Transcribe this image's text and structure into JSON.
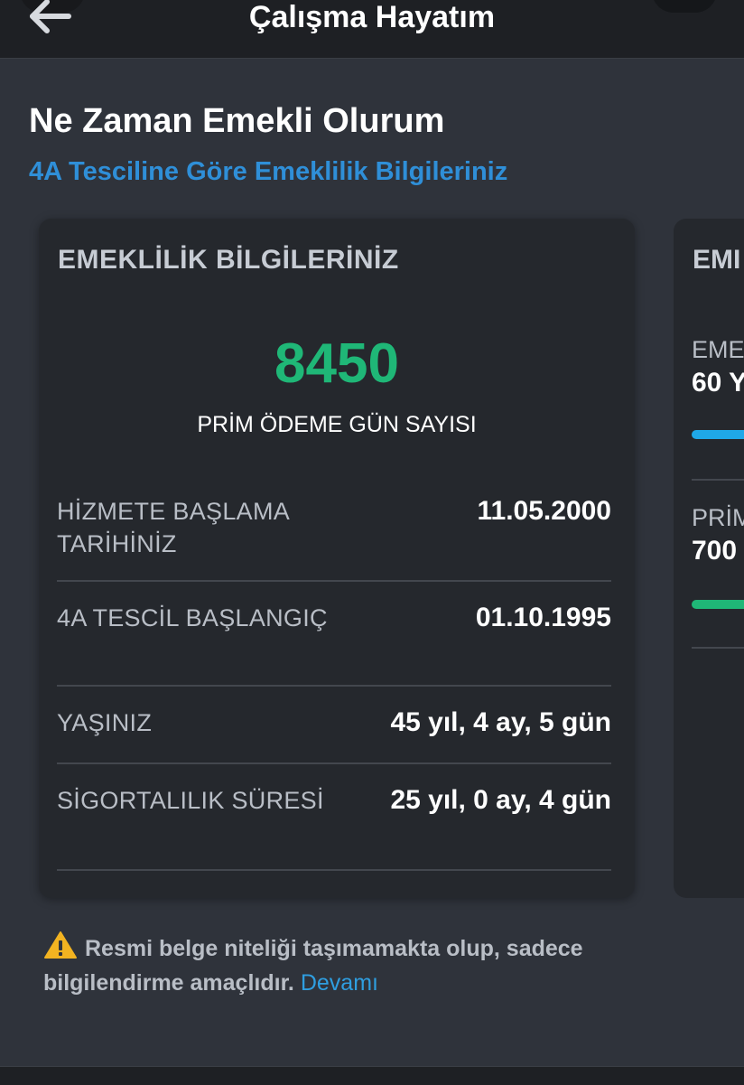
{
  "header": {
    "title": "Çalışma Hayatım"
  },
  "page": {
    "title": "Ne Zaman Emekli Olurum",
    "subtitle": "4A Tesciline Göre Emeklilik Bilgileriniz"
  },
  "card_main": {
    "title": "EMEKLİLİK BİLGİLERİNİZ",
    "big_number": "8450",
    "big_label": "PRİM ÖDEME GÜN SAYISI",
    "rows": [
      {
        "label": "HİZMETE BAŞLAMA TARİHİNİZ",
        "value": "11.05.2000"
      },
      {
        "label": "4A TESCİL BAŞLANGIÇ",
        "value": "01.10.1995"
      },
      {
        "label": "YAŞINIZ",
        "value": "45 yıl, 4 ay, 5 gün"
      },
      {
        "label": "SİGORTALILIK SÜRESİ",
        "value": "25 yıl, 0 ay, 4 gün"
      }
    ]
  },
  "card_secondary": {
    "title_partial": "EMI",
    "item1_label_partial": "EME",
    "item1_value_partial": "60 Y",
    "item2_label_partial": "PRİM",
    "item2_value_partial": "700",
    "bar_colors": [
      "#1fa8e8",
      "#1fb777"
    ]
  },
  "notice": {
    "text": "Resmi belge niteliği taşımamakta olup, sadece bilgilendirme amaçlıdır.",
    "link": "Devamı"
  },
  "colors": {
    "background": "#2f333b",
    "card": "#25282d",
    "accent_green": "#1fb777",
    "accent_blue": "#2f8fd8",
    "warning": "#f2b321"
  },
  "icons": {
    "back": "back-arrow-icon",
    "warning": "warning-triangle-icon"
  }
}
